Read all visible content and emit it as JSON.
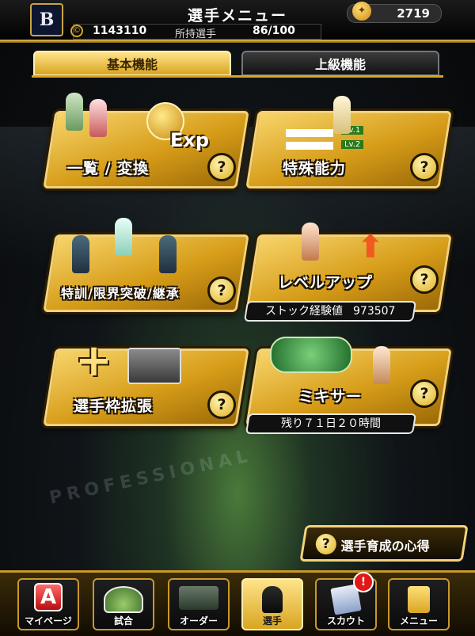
{
  "header": {
    "title": "選手メニュー",
    "team_logo": "B",
    "premium_currency": "2719",
    "gold_icon": "©",
    "gold": "1143110",
    "owned_label": "所持選手",
    "owned_value": "86/100"
  },
  "tabs": [
    {
      "label": "基本機能",
      "selected": true
    },
    {
      "label": "上級機能",
      "selected": false
    }
  ],
  "cards": {
    "list_convert": {
      "label": "一覧 / 変換",
      "exp_text": "Exp"
    },
    "special_ability": {
      "label": "特殊能力",
      "lv1": "Lv.1",
      "lv2": "Lv.2"
    },
    "training": {
      "label": "特訓/限界突破/継承"
    },
    "level_up": {
      "label": "レベルアップ",
      "info_label": "ストック経験値",
      "info_value": "973507"
    },
    "roster_expand": {
      "label": "選手枠拡張",
      "plus": "+"
    },
    "mixer": {
      "label": "ミキサー",
      "remaining": "残り７１日２０時間"
    }
  },
  "help_glyph": "?",
  "background_text": "PROFESSIONAL",
  "tips": {
    "label": "選手育成の心得"
  },
  "nav": [
    {
      "label": "マイページ",
      "icon": "mypage-icon",
      "art": "A"
    },
    {
      "label": "試合",
      "icon": "stadium-icon"
    },
    {
      "label": "オーダー",
      "icon": "order-icon"
    },
    {
      "label": "選手",
      "icon": "player-icon",
      "active": true
    },
    {
      "label": "スカウト",
      "icon": "scout-icon"
    },
    {
      "label": "メニュー",
      "icon": "menu-icon"
    }
  ],
  "alert_badge": "!",
  "colors": {
    "gold": "#d9a521",
    "dark": "#0b0b0b",
    "alert": "#e01818"
  }
}
